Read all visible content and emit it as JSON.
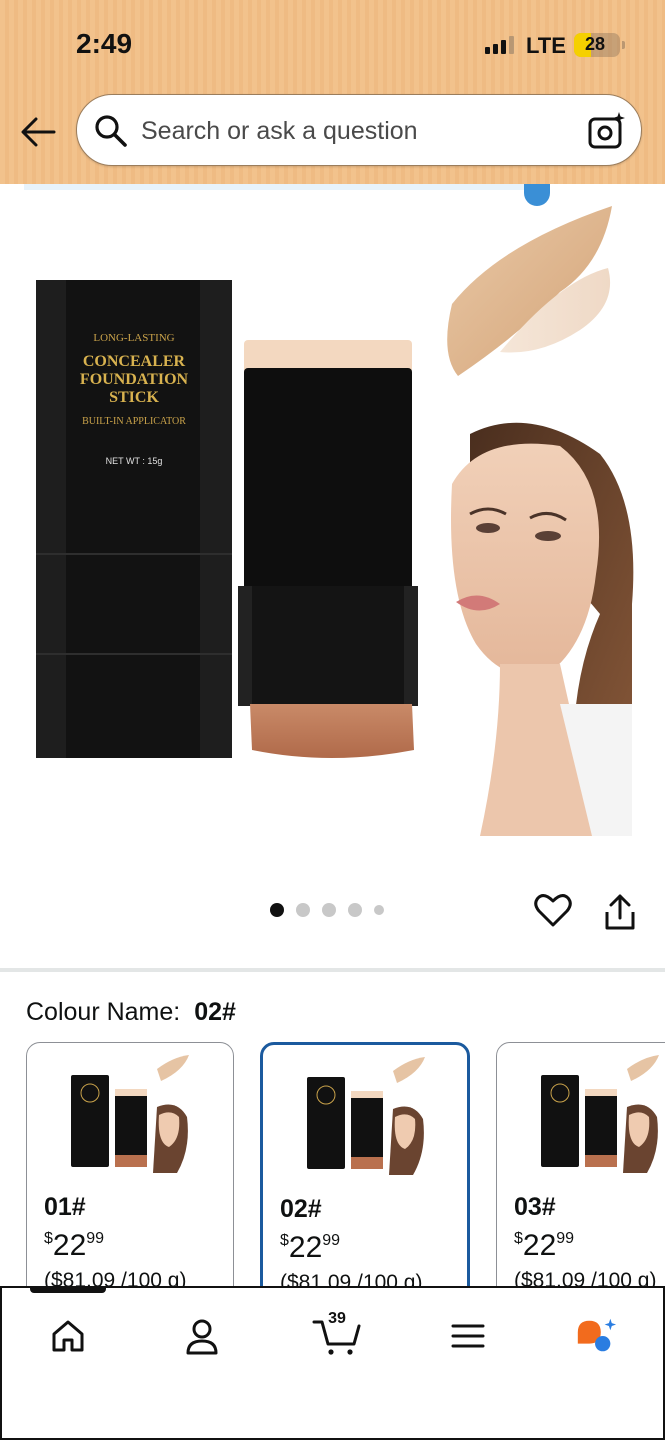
{
  "status_bar": {
    "time": "2:49",
    "network": "LTE",
    "battery": "28"
  },
  "search": {
    "placeholder": "Search or ask a question"
  },
  "product_image": {
    "brand_lines": [
      "LONG-LASTING",
      "CONCEALER",
      "FOUNDATION",
      "STICK",
      "BUILT-IN APPLICATOR",
      "NET WT : 15g"
    ],
    "page_count": 5,
    "active_page": 1
  },
  "variation": {
    "label": "Colour Name:",
    "selected": "02#"
  },
  "options": [
    {
      "name": "01#",
      "price_symbol": "$",
      "price_whole": "22",
      "price_cents": "99",
      "unit_price": "($81.09 /100 g)",
      "selected": false
    },
    {
      "name": "02#",
      "price_symbol": "$",
      "price_whole": "22",
      "price_cents": "99",
      "unit_price": "($81.09 /100 g)",
      "selected": true
    },
    {
      "name": "03#",
      "price_symbol": "$",
      "price_whole": "22",
      "price_cents": "99",
      "unit_price": "($81.09 /100 g)",
      "selected": false
    }
  ],
  "bottom_nav": {
    "items": [
      "home-icon",
      "account-icon",
      "cart-icon",
      "menu-icon",
      "rufus-assistant-icon"
    ],
    "cart_count": "39"
  },
  "colors": {
    "header": "#f2c28c",
    "selected_border": "#1b5a9e",
    "link": "#007185"
  }
}
